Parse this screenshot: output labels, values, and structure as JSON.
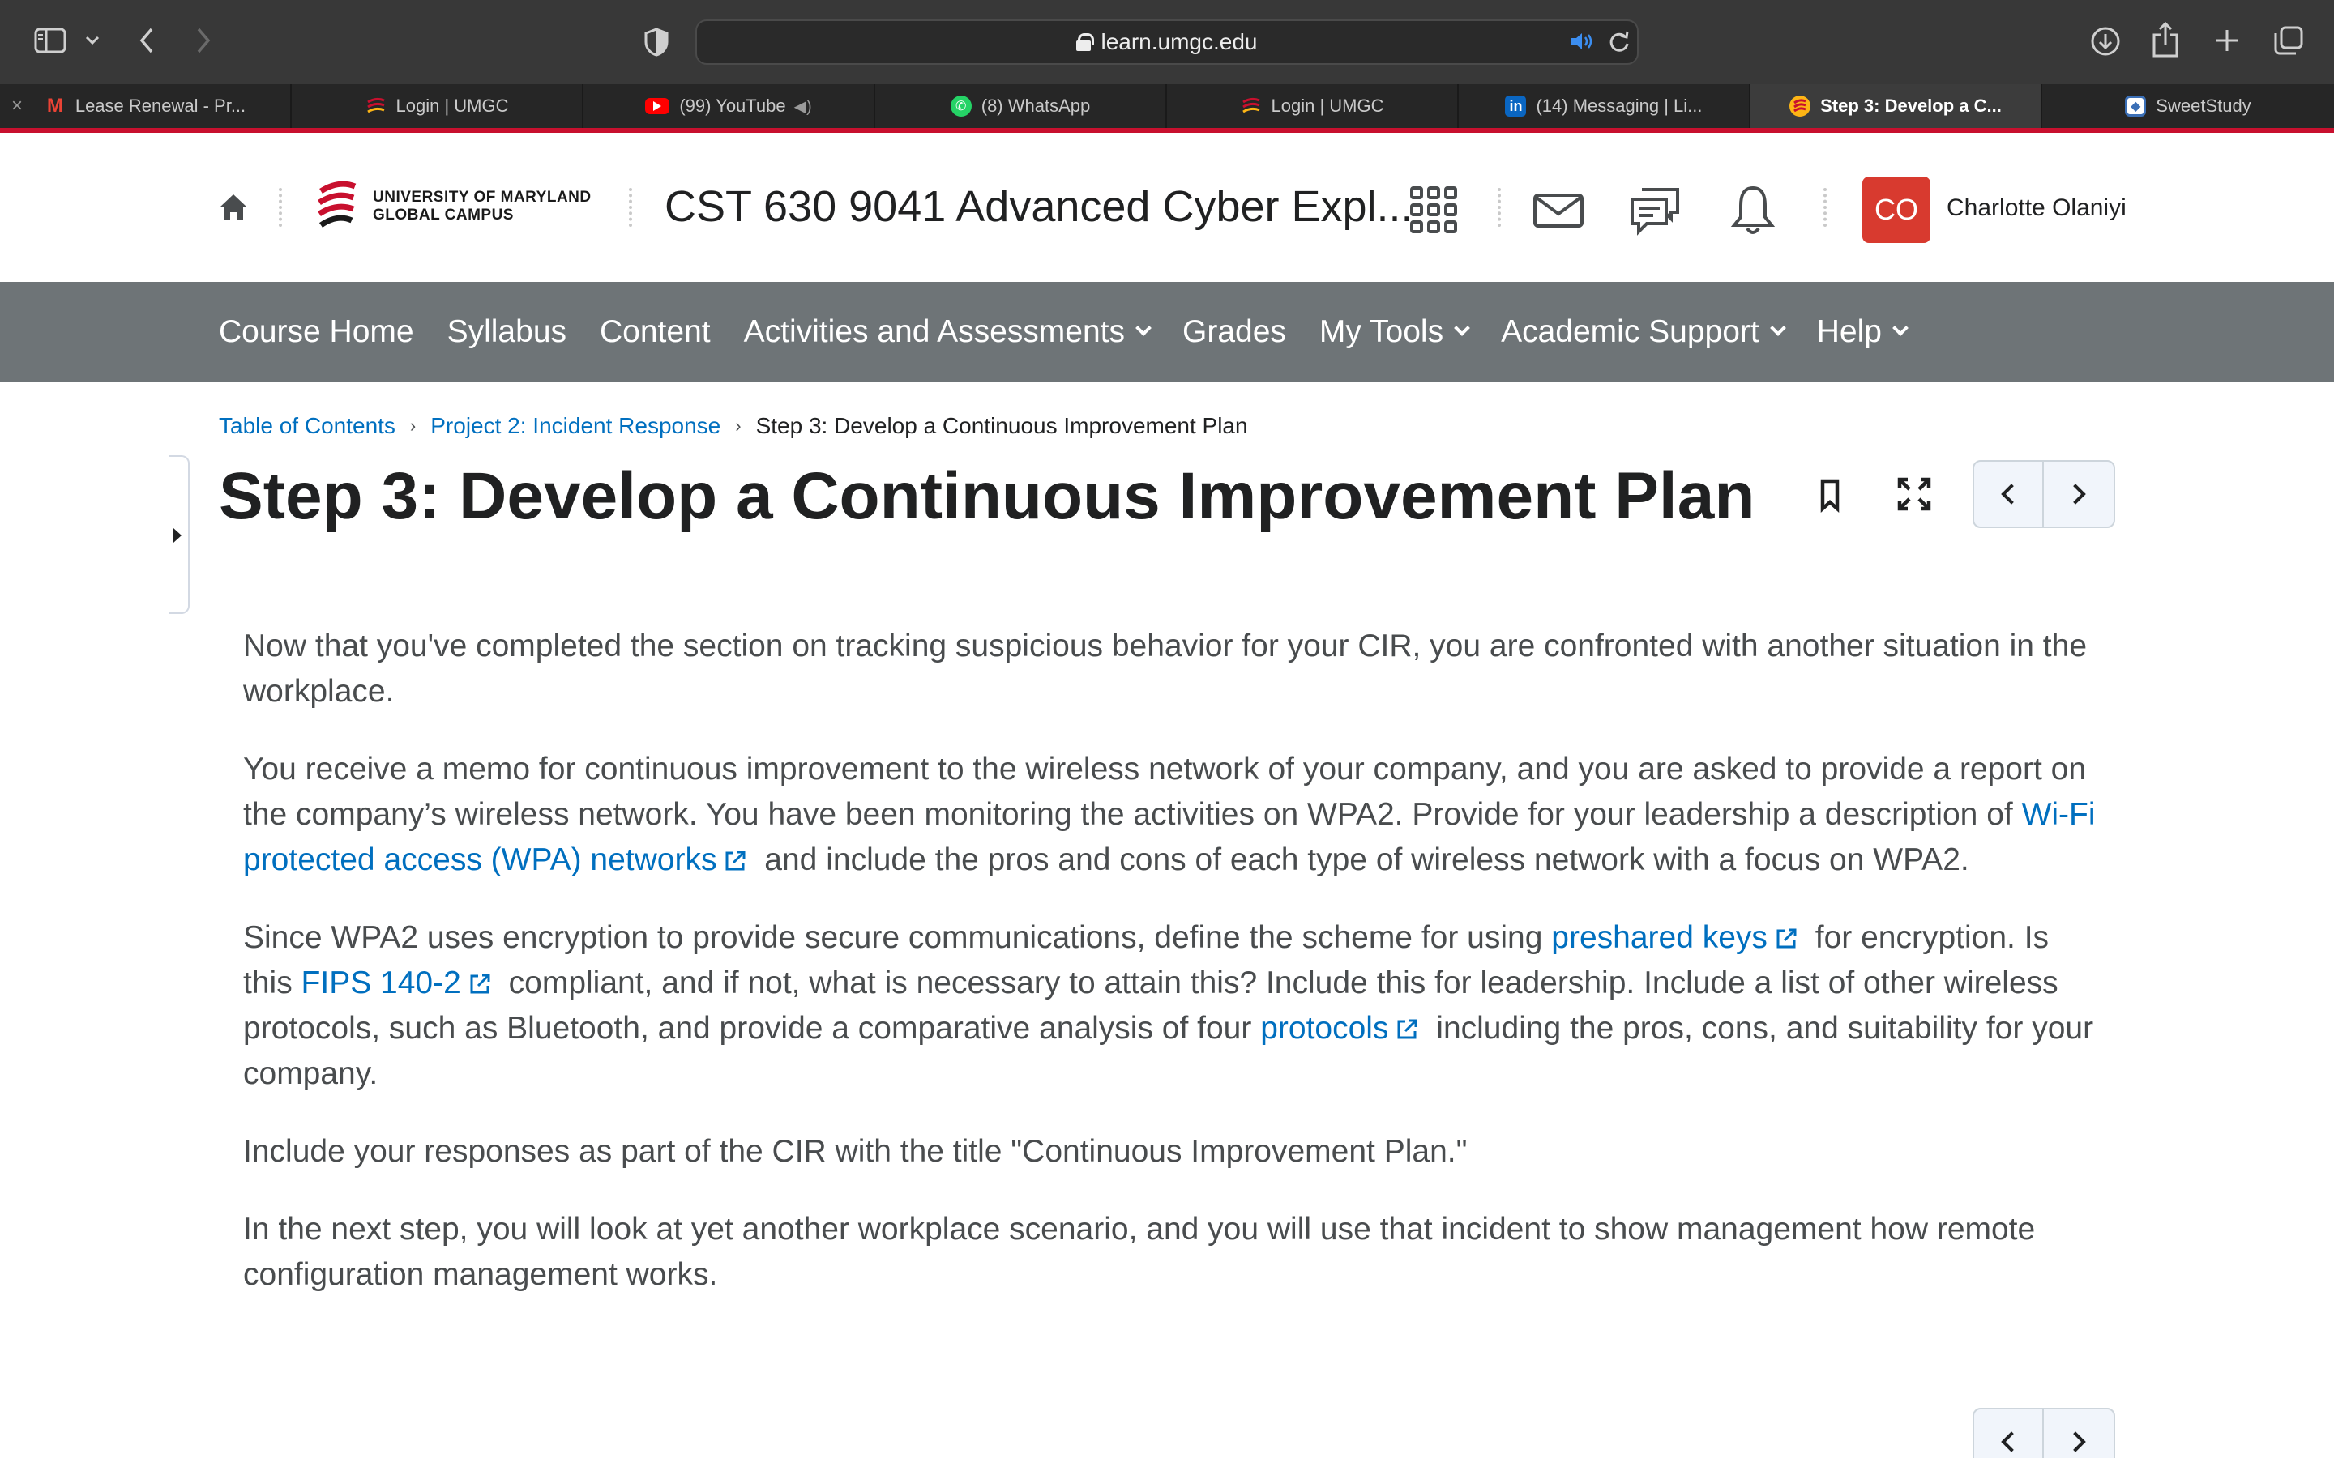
{
  "browser": {
    "url": "learn.umgc.edu",
    "tabs": [
      {
        "label": "Lease Renewal - Pr...",
        "icon": "gmail-icon",
        "color": "#ea4335"
      },
      {
        "label": "Login | UMGC",
        "icon": "umgc-icon",
        "color": "#c8102e"
      },
      {
        "label": "(99) YouTube",
        "icon": "youtube-icon",
        "color": "#ff0000"
      },
      {
        "label": "(8) WhatsApp",
        "icon": "whatsapp-icon",
        "color": "#25d366"
      },
      {
        "label": "Login | UMGC",
        "icon": "umgc-icon",
        "color": "#c8102e"
      },
      {
        "label": "(14) Messaging | Li...",
        "icon": "linkedin-icon",
        "color": "#0a66c2"
      },
      {
        "label": "Step 3: Develop a C...",
        "icon": "umgc-icon",
        "color": "#c8102e",
        "active": true
      },
      {
        "label": "SweetStudy",
        "icon": "sweetstudy-icon",
        "color": "#3b6fb6"
      }
    ]
  },
  "header": {
    "logo_line1": "UNIVERSITY OF MARYLAND",
    "logo_line2": "GLOBAL CAMPUS",
    "course_title": "CST 630 9041 Advanced Cyber Expl...",
    "user_initials": "CO",
    "user_name": "Charlotte Olaniyi",
    "accent": "#d83a2f"
  },
  "nav": {
    "items": [
      "Course Home",
      "Syllabus",
      "Content",
      "Activities and Assessments",
      "Grades",
      "My Tools",
      "Academic Support",
      "Help"
    ],
    "dropdowns": [
      false,
      false,
      false,
      true,
      false,
      true,
      true,
      true
    ]
  },
  "breadcrumb": {
    "item1": "Table of Contents",
    "item2": "Project 2: Incident Response",
    "current": "Step 3: Develop a Continuous Improvement Plan"
  },
  "page": {
    "title": "Step 3: Develop a Continuous Improvement Plan",
    "p1": "Now that you've completed the section on tracking suspicious behavior for your CIR, you are confronted with another situation in the workplace.",
    "p2_a": "You receive a memo for continuous improvement to the wireless network of your company, and you are asked to provide a report on the company’s wireless network. You have been monitoring the activities on WPA2. Provide for your leadership a description of ",
    "p2_link": "Wi-Fi protected access (WPA) networks",
    "p2_b": " and include the pros and cons of each type of wireless network with a focus on WPA2.",
    "p3_a": "Since WPA2 uses encryption to provide secure communications, define the scheme for using ",
    "p3_link1": "preshared keys",
    "p3_b": " for encryption. Is this ",
    "p3_link2": "FIPS 140-2",
    "p3_c": " compliant, and if not, what is necessary to attain this? Include this for leadership. Include a list of other wireless protocols, such as Bluetooth, and provide a comparative analysis of four ",
    "p3_link3": "protocols",
    "p3_d": " including the pros, cons, and suitability for your company.",
    "p4": "Include your responses as part of the CIR with the title \"Continuous Improvement Plan.\"",
    "p5": "In the next step, you will look at yet another workplace scenario, and you will use that incident to show management how remote configuration management works.",
    "link_color": "#006fbf"
  }
}
